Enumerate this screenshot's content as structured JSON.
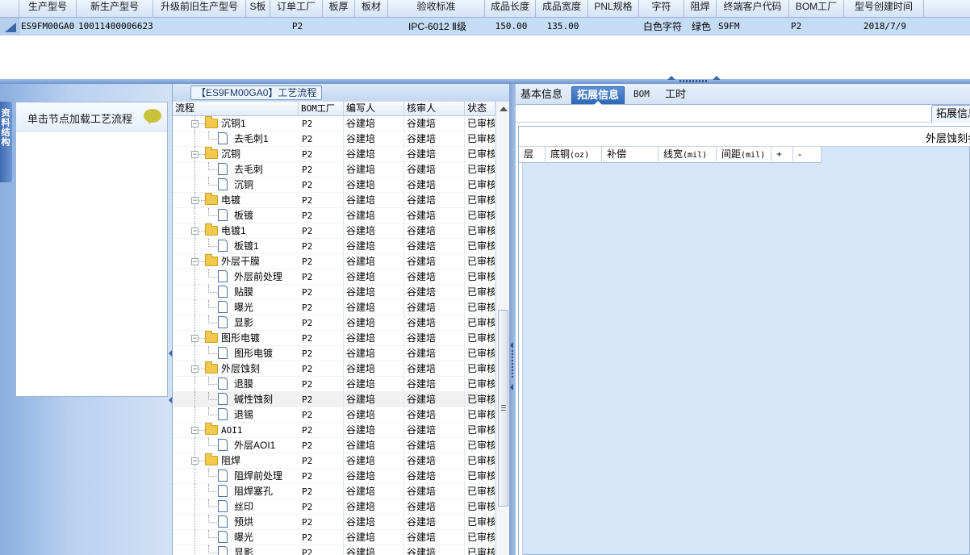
{
  "top_grid": {
    "columns": [
      "生产型号",
      "新生产型号",
      "升级前旧生产型号",
      "S板",
      "订单工厂",
      "板厚",
      "板材",
      "验收标准",
      "成品长度",
      "成品宽度",
      "PNL规格",
      "字符",
      "阻焊",
      "终端客户代码",
      "BOM工厂",
      "型号创建时间"
    ],
    "row": {
      "production_model": "ES9FM00GA0",
      "new_production_model": "10011400006623",
      "old_production_model": "",
      "s_board": "",
      "order_factory": "P2",
      "thickness": "",
      "material": "",
      "acceptance_standard": "IPC-6012 Ⅱ级",
      "length": "150.00",
      "width": "135.00",
      "pnl_spec": "",
      "character": "白色字符",
      "solder_mask": "绿色",
      "customer_code": "S9FM",
      "bom_factory": "P2",
      "created": "2018/7/9"
    }
  },
  "left_nav": {
    "vertical_tab": "资料结构",
    "panel_header": "单击节点加载工艺流程"
  },
  "process_panel": {
    "title": "【ES9FM00GA0】工艺流程",
    "columns": [
      "流程",
      "BOM工厂",
      "编写人",
      "核审人",
      "状态"
    ],
    "rows": [
      {
        "level": 1,
        "type": "folder",
        "name": "沉铜1",
        "bom": "P2",
        "author": "谷建培",
        "reviewer": "谷建培",
        "status": "已审核"
      },
      {
        "level": 2,
        "type": "doc",
        "name": "去毛刺1",
        "bom": "P2",
        "author": "谷建培",
        "reviewer": "谷建培",
        "status": "已审核"
      },
      {
        "level": 1,
        "type": "folder",
        "name": "沉铜",
        "bom": "P2",
        "author": "谷建培",
        "reviewer": "谷建培",
        "status": "已审核"
      },
      {
        "level": 2,
        "type": "doc",
        "name": "去毛刺",
        "bom": "P2",
        "author": "谷建培",
        "reviewer": "谷建培",
        "status": "已审核"
      },
      {
        "level": 2,
        "type": "doc",
        "name": "沉铜",
        "bom": "P2",
        "author": "谷建培",
        "reviewer": "谷建培",
        "status": "已审核"
      },
      {
        "level": 1,
        "type": "folder",
        "name": "电镀",
        "bom": "P2",
        "author": "谷建培",
        "reviewer": "谷建培",
        "status": "已审核"
      },
      {
        "level": 2,
        "type": "doc",
        "name": "板镀",
        "bom": "P2",
        "author": "谷建培",
        "reviewer": "谷建培",
        "status": "已审核"
      },
      {
        "level": 1,
        "type": "folder",
        "name": "电镀1",
        "bom": "P2",
        "author": "谷建培",
        "reviewer": "谷建培",
        "status": "已审核"
      },
      {
        "level": 2,
        "type": "doc",
        "name": "板镀1",
        "bom": "P2",
        "author": "谷建培",
        "reviewer": "谷建培",
        "status": "已审核"
      },
      {
        "level": 1,
        "type": "folder",
        "name": "外层干膜",
        "bom": "P2",
        "author": "谷建培",
        "reviewer": "谷建培",
        "status": "已审核"
      },
      {
        "level": 2,
        "type": "doc",
        "name": "外层前处理",
        "bom": "P2",
        "author": "谷建培",
        "reviewer": "谷建培",
        "status": "已审核"
      },
      {
        "level": 2,
        "type": "doc",
        "name": "贴膜",
        "bom": "P2",
        "author": "谷建培",
        "reviewer": "谷建培",
        "status": "已审核"
      },
      {
        "level": 2,
        "type": "doc",
        "name": "曝光",
        "bom": "P2",
        "author": "谷建培",
        "reviewer": "谷建培",
        "status": "已审核"
      },
      {
        "level": 2,
        "type": "doc",
        "name": "显影",
        "bom": "P2",
        "author": "谷建培",
        "reviewer": "谷建培",
        "status": "已审核"
      },
      {
        "level": 1,
        "type": "folder",
        "name": "图形电镀",
        "bom": "P2",
        "author": "谷建培",
        "reviewer": "谷建培",
        "status": "已审核"
      },
      {
        "level": 2,
        "type": "doc",
        "name": "图形电镀",
        "bom": "P2",
        "author": "谷建培",
        "reviewer": "谷建培",
        "status": "已审核"
      },
      {
        "level": 1,
        "type": "folder",
        "name": "外层蚀刻",
        "bom": "P2",
        "author": "谷建培",
        "reviewer": "谷建培",
        "status": "已审核"
      },
      {
        "level": 2,
        "type": "doc",
        "name": "退膜",
        "bom": "P2",
        "author": "谷建培",
        "reviewer": "谷建培",
        "status": "已审核"
      },
      {
        "level": 2,
        "type": "doc",
        "name": "碱性蚀刻",
        "bom": "P2",
        "author": "谷建培",
        "reviewer": "谷建培",
        "status": "已审核",
        "selected": true
      },
      {
        "level": 2,
        "type": "doc",
        "name": "退锡",
        "bom": "P2",
        "author": "谷建培",
        "reviewer": "谷建培",
        "status": "已审核"
      },
      {
        "level": 1,
        "type": "folder",
        "name": "AOI1",
        "bom": "P2",
        "author": "谷建培",
        "reviewer": "谷建培",
        "status": "已审核"
      },
      {
        "level": 2,
        "type": "doc",
        "name": "外层AOI1",
        "bom": "P2",
        "author": "谷建培",
        "reviewer": "谷建培",
        "status": "已审核"
      },
      {
        "level": 1,
        "type": "folder",
        "name": "阻焊",
        "bom": "P2",
        "author": "谷建培",
        "reviewer": "谷建培",
        "status": "已审核"
      },
      {
        "level": 2,
        "type": "doc",
        "name": "阻焊前处理",
        "bom": "P2",
        "author": "谷建培",
        "reviewer": "谷建培",
        "status": "已审核"
      },
      {
        "level": 2,
        "type": "doc",
        "name": "阻焊塞孔",
        "bom": "P2",
        "author": "谷建培",
        "reviewer": "谷建培",
        "status": "已审核"
      },
      {
        "level": 2,
        "type": "doc",
        "name": "丝印",
        "bom": "P2",
        "author": "谷建培",
        "reviewer": "谷建培",
        "status": "已审核"
      },
      {
        "level": 2,
        "type": "doc",
        "name": "预烘",
        "bom": "P2",
        "author": "谷建培",
        "reviewer": "谷建培",
        "status": "已审核"
      },
      {
        "level": 2,
        "type": "doc",
        "name": "曝光",
        "bom": "P2",
        "author": "谷建培",
        "reviewer": "谷建培",
        "status": "已审核"
      },
      {
        "level": 2,
        "type": "doc",
        "name": "显影",
        "bom": "P2",
        "author": "谷建培",
        "reviewer": "谷建培",
        "status": "已审核"
      }
    ]
  },
  "right_panel": {
    "tabs": [
      "基本信息",
      "拓展信息",
      "BOM",
      "工时"
    ],
    "active_tab": "拓展信息",
    "inner_tab": "拓展信息",
    "detail_caption": "外层蚀刻参",
    "layer_columns": [
      {
        "label": "层",
        "unit": ""
      },
      {
        "label": "底铜",
        "unit": "(oz)"
      },
      {
        "label": "补偿",
        "unit": ""
      },
      {
        "label": "线宽",
        "unit": "(mil)"
      },
      {
        "label": "间距",
        "unit": "(mil)"
      },
      {
        "label": "+",
        "unit": ""
      },
      {
        "label": "-",
        "unit": ""
      }
    ]
  },
  "colors": {
    "selected_row": "#c5dcf7",
    "active_tab": "#2f66b6",
    "folder": "#f2c94c",
    "frame_blue": "#8aaee0"
  }
}
